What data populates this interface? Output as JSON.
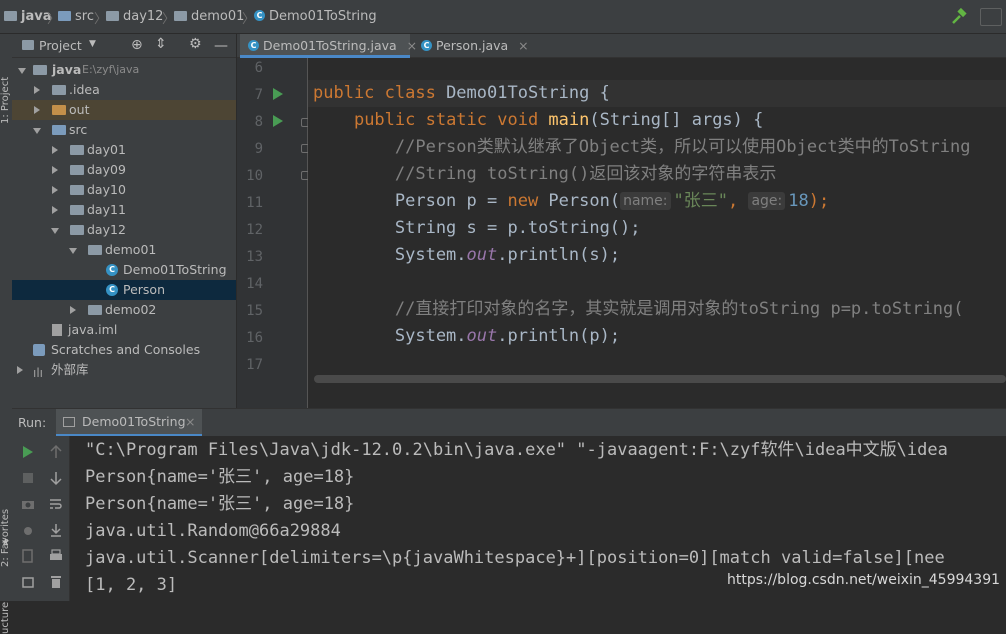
{
  "navbar": {
    "crumbs": [
      "java",
      "src",
      "day12",
      "demo01",
      "Demo01ToString"
    ]
  },
  "left_strip": {
    "project_label": "1: Project",
    "favorites_label": "2: Favorites",
    "structure_label": "ucture"
  },
  "project_panel": {
    "title": "Project",
    "tree": [
      {
        "label": "java",
        "extra": "E:\\zyf\\java"
      },
      {
        "label": ".idea"
      },
      {
        "label": "out"
      },
      {
        "label": "src"
      },
      {
        "label": "day01"
      },
      {
        "label": "day09"
      },
      {
        "label": "day10"
      },
      {
        "label": "day11"
      },
      {
        "label": "day12"
      },
      {
        "label": "demo01"
      },
      {
        "label": "Demo01ToString"
      },
      {
        "label": "Person"
      },
      {
        "label": "demo02"
      },
      {
        "label": "java.iml"
      },
      {
        "label": "Scratches and Consoles"
      },
      {
        "label": "外部库"
      }
    ]
  },
  "editor": {
    "tabs": [
      {
        "label": "Demo01ToString.java",
        "close": "×"
      },
      {
        "label": "Person.java",
        "close": "×"
      }
    ],
    "line_numbers": [
      "6",
      "7",
      "8",
      "9",
      "10",
      "11",
      "12",
      "13",
      "14",
      "15",
      "16",
      "17"
    ],
    "code": {
      "l7_kw": "public class ",
      "l7_name": "Demo01ToString",
      "l7_rest": " {",
      "l8_indent": "    ",
      "l8_kw": "public static void ",
      "l8_fn": "main",
      "l8_rest": "(String[] args) {",
      "l9": "        //Person类默认继承了Object类，所以可以使用Object类中的ToString",
      "l10": "        //String toString()返回该对象的字符串表示",
      "l11_a": "        Person p = ",
      "l11_new": "new",
      "l11_b": " Person(",
      "l11_hint1": "name:",
      "l11_str": "\"张三\"",
      "l11_comma": ", ",
      "l11_hint2": "age:",
      "l11_num": "18",
      "l11_end": ");",
      "l12": "        String s = p.toString();",
      "l13_a": "        System.",
      "l13_out": "out",
      "l13_b": ".println(s);",
      "l15": "        //直接打印对象的名字，其实就是调用对象的toString p=p.toString(",
      "l16_a": "        System.",
      "l16_out": "out",
      "l16_b": ".println(p);"
    }
  },
  "run_panel": {
    "run_label": "Run:",
    "tab_label": "Demo01ToString",
    "tab_close": "×",
    "console_lines": [
      "\"C:\\Program Files\\Java\\jdk-12.0.2\\bin\\java.exe\" \"-javaagent:F:\\zyf软件\\idea中文版\\idea",
      "Person{name='张三', age=18}",
      "Person{name='张三', age=18}",
      "java.util.Random@66a29884",
      "java.util.Scanner[delimiters=\\p{javaWhitespace}+][position=0][match valid=false][nee",
      "[1, 2, 3]"
    ]
  },
  "watermark": "https://blog.csdn.net/weixin_45994391",
  "colors": {
    "keyword": "#cc7832",
    "function": "#ffc66d",
    "comment": "#808080",
    "string": "#6a8759",
    "number": "#6897bb",
    "field": "#9876aa",
    "run_green": "#499c54",
    "selection": "#0d293e"
  }
}
